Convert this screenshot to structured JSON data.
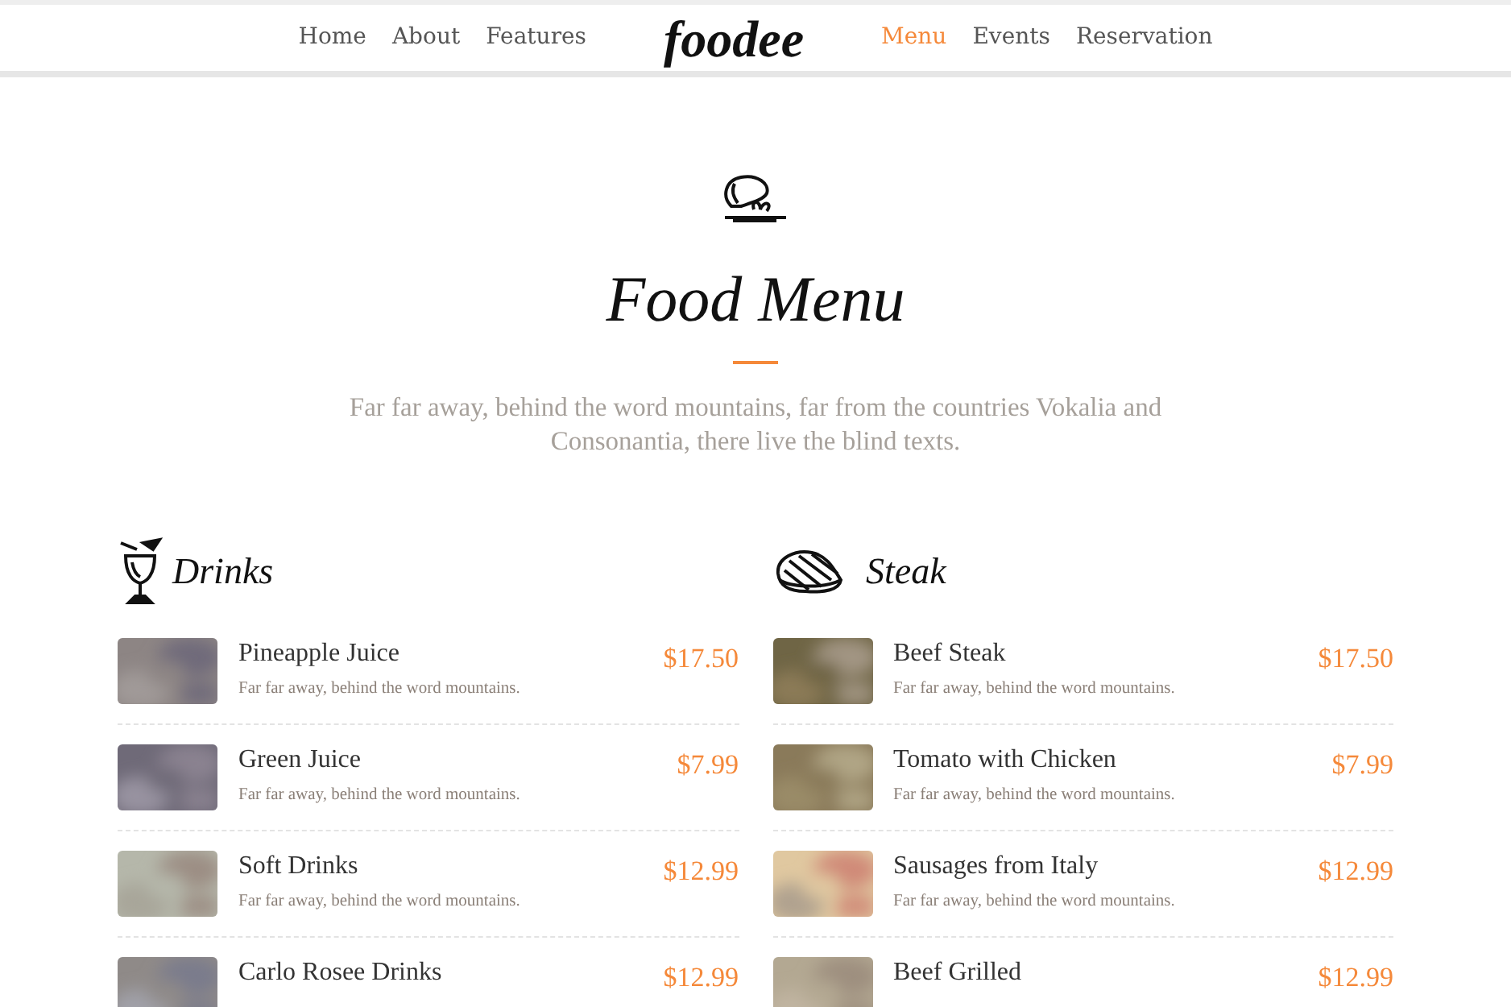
{
  "navbar": {
    "brand": "foodee",
    "left_links": [
      {
        "label": "Home",
        "selected": false
      },
      {
        "label": "About",
        "selected": false
      },
      {
        "label": "Features",
        "selected": false
      }
    ],
    "right_links": [
      {
        "label": "Menu",
        "selected": true
      },
      {
        "label": "Events",
        "selected": false
      },
      {
        "label": "Reservation",
        "selected": false
      }
    ]
  },
  "heading": {
    "title": "Food Menu",
    "subtitle": "Far far away, behind the word mountains, far from the countries Vokalia and Consonantia, there live the blind texts."
  },
  "sections": [
    {
      "kind": "drinks",
      "title": "Drinks",
      "items": [
        {
          "name": "Pineapple Juice",
          "description": "Far far away, behind the word mountains.",
          "price": "$17.50"
        },
        {
          "name": "Green Juice",
          "description": "Far far away, behind the word mountains.",
          "price": "$7.99"
        },
        {
          "name": "Soft Drinks",
          "description": "Far far away, behind the word mountains.",
          "price": "$12.99"
        },
        {
          "name": "Carlo Rosee Drinks",
          "price": "$12.99"
        }
      ]
    },
    {
      "kind": "steak",
      "title": "Steak",
      "items": [
        {
          "name": "Beef Steak",
          "description": "Far far away, behind the word mountains.",
          "price": "$17.50"
        },
        {
          "name": "Tomato with Chicken",
          "description": "Far far away, behind the word mountains.",
          "price": "$7.99"
        },
        {
          "name": "Sausages from Italy",
          "description": "Far far away, behind the word mountains.",
          "price": "$12.99"
        },
        {
          "name": "Beef Grilled",
          "price": "$12.99"
        }
      ]
    }
  ]
}
